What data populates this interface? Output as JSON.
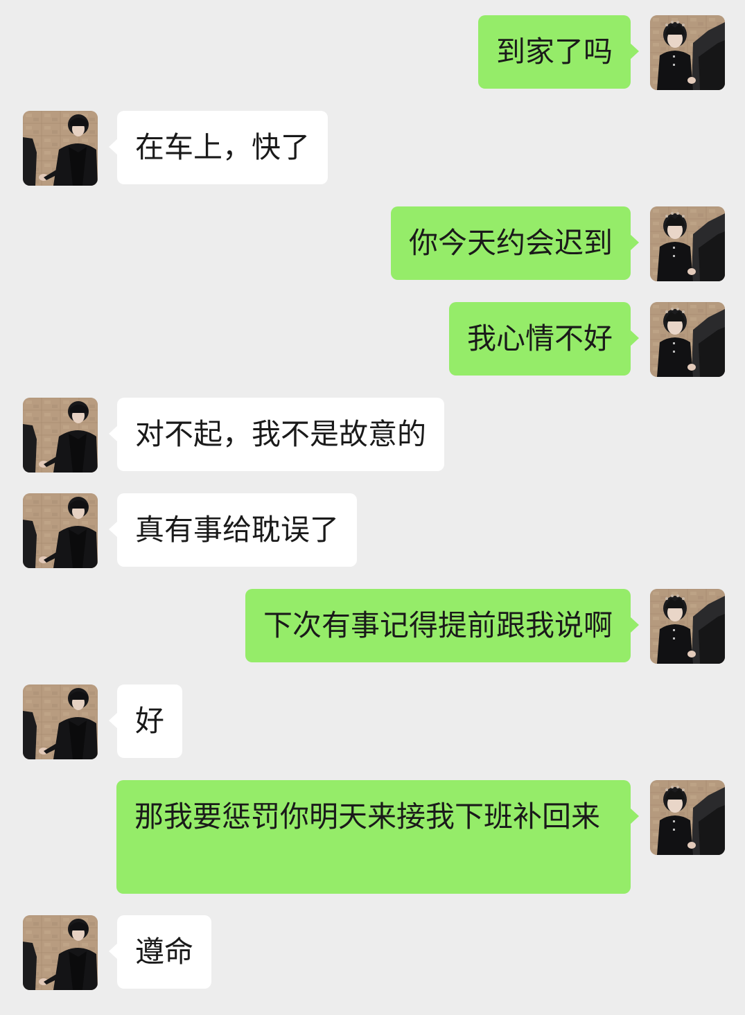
{
  "messages": [
    {
      "side": "right",
      "text": "到家了吗",
      "avatar": "girl-avatar"
    },
    {
      "side": "left",
      "text": "在车上，快了",
      "avatar": "boy-avatar"
    },
    {
      "side": "right",
      "text": "你今天约会迟到",
      "avatar": "girl-avatar"
    },
    {
      "side": "right",
      "text": "我心情不好",
      "avatar": "girl-avatar"
    },
    {
      "side": "left",
      "text": "对不起，我不是故意的",
      "avatar": "boy-avatar"
    },
    {
      "side": "left",
      "text": "真有事给耽误了",
      "avatar": "boy-avatar"
    },
    {
      "side": "right",
      "text": "下次有事记得提前跟我说啊",
      "avatar": "girl-avatar"
    },
    {
      "side": "left",
      "text": "好",
      "avatar": "boy-avatar"
    },
    {
      "side": "right",
      "text": "那我要惩罚你明天来接我下班补回来",
      "avatar": "girl-avatar"
    },
    {
      "side": "left",
      "text": "遵命",
      "avatar": "boy-avatar"
    }
  ],
  "colors": {
    "background": "#ededed",
    "sent_bubble": "#95ec69",
    "received_bubble": "#ffffff",
    "text": "#1a1a1a"
  }
}
